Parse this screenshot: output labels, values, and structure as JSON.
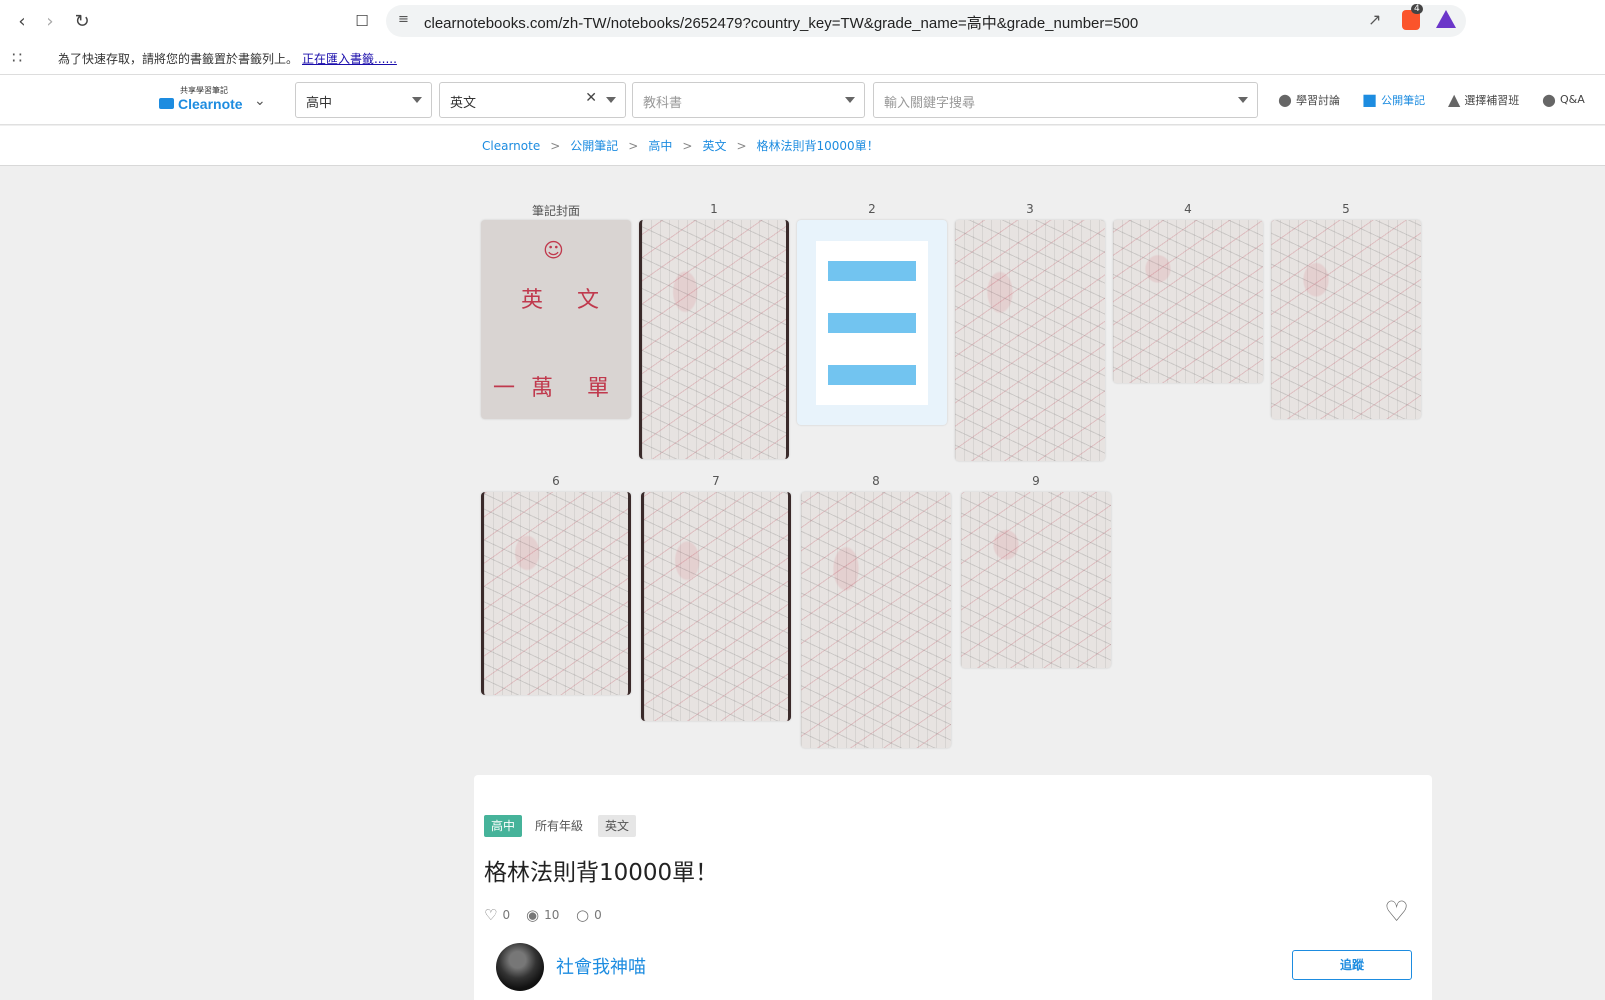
{
  "browser": {
    "url": "clearnotebooks.com/zh-TW/notebooks/2652479?country_key=TW&grade_name=高中&grade_number=500",
    "brave_badge_count": "4",
    "bookmarks_prompt": "為了快速存取，請將您的書籤置於書籤列上。",
    "bookmarks_link": "正在匯入書籤......"
  },
  "site_header": {
    "logo_sub": "共享學習筆記",
    "logo_name": "Clearnote",
    "school_select": "高中",
    "subject_select": "英文",
    "textbook_placeholder": "教科書",
    "search_placeholder": "輸入關鍵字搜尋",
    "nav": [
      "學習討論",
      "公開筆記",
      "選擇補習班",
      "Q&A"
    ]
  },
  "breadcrumb": [
    "Clearnote",
    "公開筆記",
    "高中",
    "英文",
    "格林法則背10000單！"
  ],
  "pages": {
    "labels": [
      "筆記封面",
      "1",
      "2",
      "3",
      "4",
      "5",
      "6",
      "7",
      "8",
      "9"
    ],
    "cover_text": [
      "英",
      "文",
      "一",
      "萬",
      "單"
    ]
  },
  "notebook": {
    "tags": [
      "高中",
      "所有年級",
      "英文"
    ],
    "title": "格林法則背10000單！",
    "likes": "0",
    "views": "10",
    "comments": "0",
    "author": "社會我神喵",
    "follow_label": "追蹤"
  },
  "colors": {
    "accent": "#1d8ce0",
    "tag_green": "#46b39a",
    "note_red": "#c0394d"
  }
}
